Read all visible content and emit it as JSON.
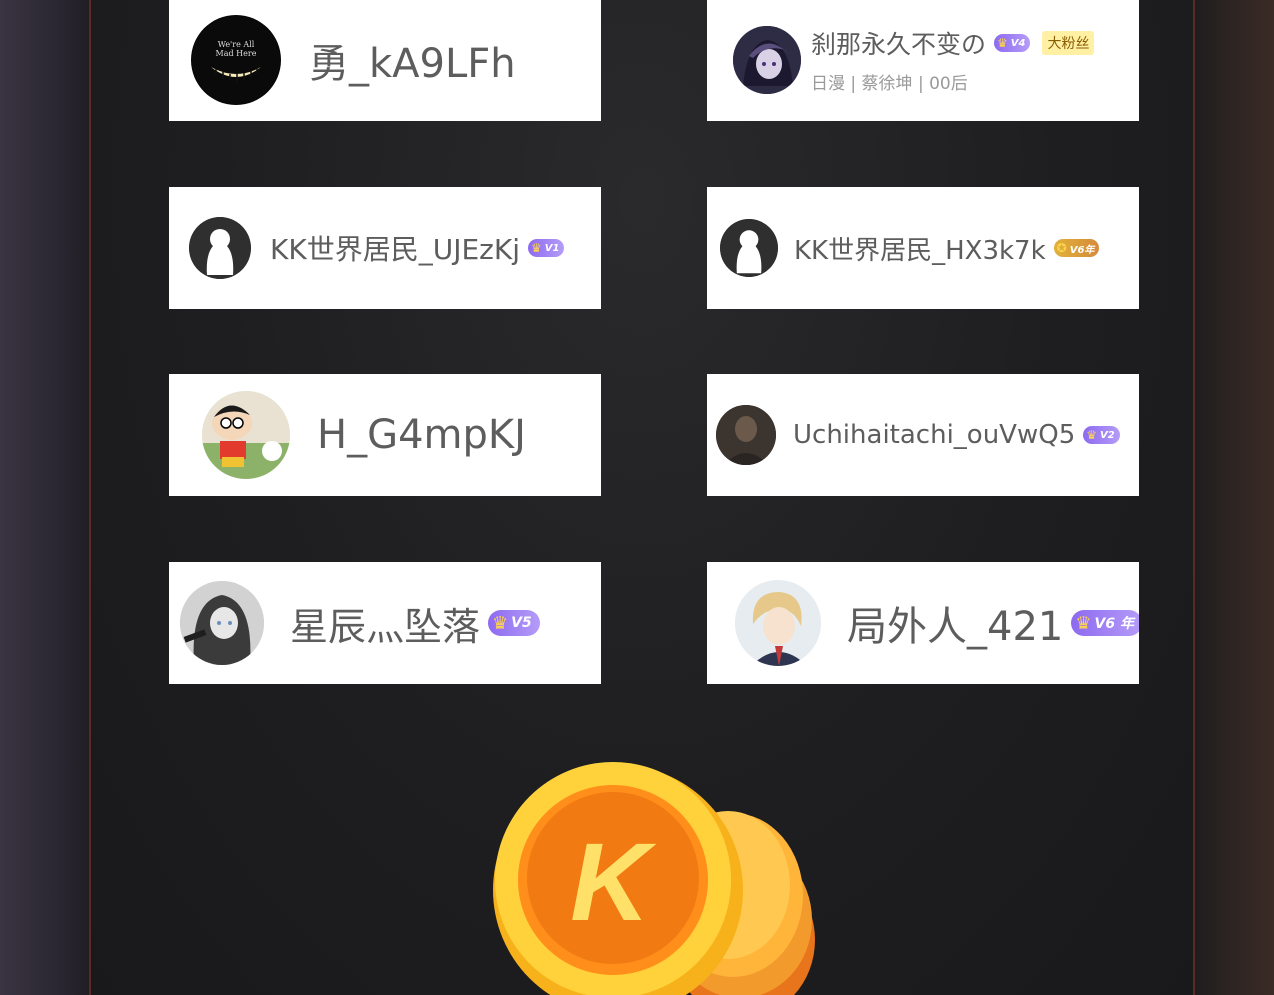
{
  "users": [
    {
      "name": "勇_kA9LFh",
      "avatar": "smile-grin-avatar"
    },
    {
      "name": "刹那永久不变の",
      "badge": "V4",
      "tag": "大粉丝",
      "subline": "日漫 | 蔡徐坤 | 00后",
      "avatar": "anime-girl-avatar"
    },
    {
      "name": "KK世界居民_UJEzKj",
      "badge": "V1",
      "avatar": "default-ghost-avatar"
    },
    {
      "name": "KK世界居民_HX3k7k",
      "badge": "V6年",
      "avatar": "default-ghost-avatar"
    },
    {
      "name": "H_G4mpKJ",
      "avatar": "crayon-shin-avatar"
    },
    {
      "name": "Uchihaitachi_ouVwQ5",
      "badge": "V2",
      "avatar": "dark-photo-avatar"
    },
    {
      "name": "星辰灬坠落",
      "badge": "V5",
      "avatar": "gray-anime-avatar"
    },
    {
      "name": "局外人_421",
      "badge": "V6 年",
      "avatar": "blond-anime-avatar"
    }
  ],
  "coin": {
    "letter": "K"
  },
  "colors": {
    "card": "#ffffff",
    "name": "#5d5d5d",
    "badge": "#8d6af0",
    "coin": "#ff9a1f",
    "border": "#5a2a24"
  }
}
